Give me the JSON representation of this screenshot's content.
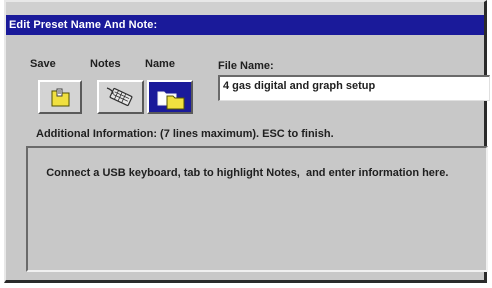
{
  "dialog": {
    "title": "Edit Preset Name And Note:"
  },
  "toolbar": {
    "save_label": "Save",
    "notes_label": "Notes",
    "name_label": "Name",
    "save_icon": "folder-save-icon",
    "notes_icon": "keyboard-icon",
    "name_icon": "folder-name-icon",
    "active_tool": "Name"
  },
  "file": {
    "label": "File Name:",
    "value": "4 gas digital and graph setup"
  },
  "info": {
    "label": "Additional Information: (7 lines maximum). ESC to finish.",
    "text": "Connect a USB keyboard, tab to highlight Notes,  and enter information here."
  },
  "colors": {
    "title_bar": "#1a1a9a",
    "dialog_bg": "#c8c8c8",
    "active_button": "#1a1a9a",
    "folder_yellow": "#f0e040"
  }
}
